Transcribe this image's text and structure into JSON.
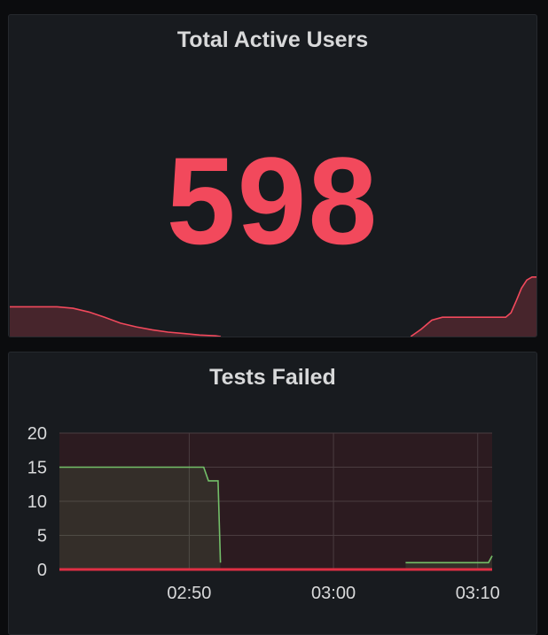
{
  "colors": {
    "background": "#0b0c0e",
    "panel": "#181b1f",
    "stat_red": "#f2495c",
    "line_green": "#73bf69",
    "threshold_red": "#e02f44"
  },
  "stat_panel": {
    "title": "Total Active Users",
    "value": "598",
    "sparkline": {
      "type": "area",
      "points": [
        [
          0,
          40
        ],
        [
          5,
          40
        ],
        [
          9,
          40
        ],
        [
          12,
          38
        ],
        [
          15,
          33
        ],
        [
          18,
          26
        ],
        [
          21,
          18
        ],
        [
          24,
          13
        ],
        [
          27,
          9
        ],
        [
          30,
          6
        ],
        [
          33,
          4
        ],
        [
          36,
          2
        ],
        [
          39,
          1
        ],
        [
          40,
          0
        ],
        [
          41,
          null
        ],
        [
          76,
          null
        ],
        [
          76,
          0
        ],
        [
          78,
          10
        ],
        [
          80,
          22
        ],
        [
          82,
          26
        ],
        [
          85,
          26
        ],
        [
          88,
          26
        ],
        [
          91,
          26
        ],
        [
          94,
          26
        ],
        [
          95,
          32
        ],
        [
          96,
          48
        ],
        [
          97,
          65
        ],
        [
          98,
          76
        ],
        [
          99,
          80
        ],
        [
          100,
          80
        ]
      ]
    }
  },
  "graph_panel": {
    "title": "Tests Failed",
    "chart_data": {
      "type": "line",
      "title": "Tests Failed",
      "xlabel": "",
      "ylabel": "",
      "x_ticks": [
        "02:50",
        "03:00",
        "03:10"
      ],
      "y_ticks": [
        "0",
        "5",
        "10",
        "15",
        "20"
      ],
      "xlim": [
        "02:41",
        "03:11"
      ],
      "ylim": [
        0,
        20
      ],
      "grid": true,
      "legend": "none",
      "series": [
        {
          "color": "#73bf69",
          "fill": true,
          "segments": [
            [
              [
                "02:41",
                15
              ],
              [
                "02:51",
                15
              ],
              [
                "02:51:20",
                13
              ],
              [
                "02:52",
                13
              ],
              [
                "02:52:10",
                1
              ]
            ],
            [
              [
                "03:05",
                1
              ],
              [
                "03:10:45",
                1
              ],
              [
                "03:11",
                2
              ]
            ]
          ]
        },
        {
          "color": "#e02f44",
          "fill": false,
          "segments": [
            [
              [
                "02:41",
                0
              ],
              [
                "03:11",
                0
              ]
            ]
          ]
        }
      ]
    }
  }
}
